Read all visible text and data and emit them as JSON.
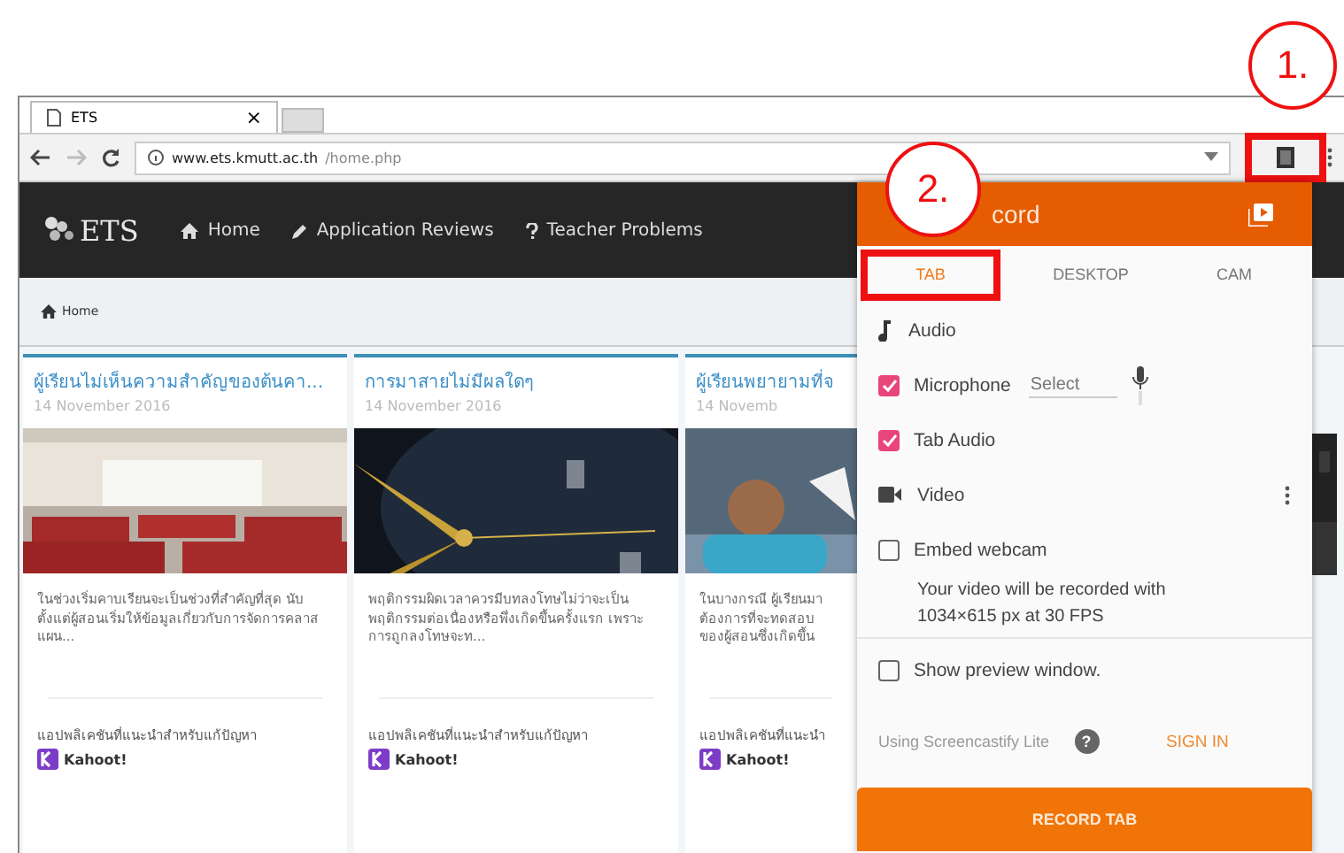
{
  "browser": {
    "tab_title": "ETS",
    "tab_close": "×",
    "url_host": "www.ets.kmutt.ac.th",
    "url_path": "/home.php"
  },
  "site": {
    "logo": "ETS",
    "nav": [
      {
        "label": "Home"
      },
      {
        "label": "Application Reviews"
      },
      {
        "label": "Teacher Problems"
      }
    ],
    "breadcrumb": "Home"
  },
  "cards": [
    {
      "title": "ผู้เรียนไม่เห็นความสำคัญของต้นคา...",
      "date": "14 November 2016",
      "body": "ในช่วงเริ่มคาบเรียนจะเป็นช่วงที่สำคัญที่สุด นับตั้งแต่ผู้สอนเริ่มให้ข้อมูลเกี่ยวกับการจัดการคลาส แผน...",
      "footer": "แอปพลิเคชันที่แนะนำสำหรับแก้ปัญหา",
      "app": "Kahoot!"
    },
    {
      "title": "การมาสายไม่มีผลใดๆ",
      "date": "14 November 2016",
      "body": "พฤติกรรมผิดเวลาควรมีบทลงโทษไม่ว่าจะเป็นพฤติกรรมต่อเนื่องหรือพึ่งเกิดขึ้นครั้งแรก เพราะการถูกลงโทษจะท...",
      "footer": "แอปพลิเคชันที่แนะนำสำหรับแก้ปัญหา",
      "app": "Kahoot!"
    },
    {
      "title": "ผู้เรียนพยายามที่จ",
      "date": "14 Novemb",
      "body": "ในบางกรณี ผู้เรียนมา\nต้องการที่จะทดสอบ\nของผู้สอนซึ่งเกิดขึ้น",
      "footer": "แอปพลิเคชันที่แนะนำ",
      "app": "Kahoot!"
    }
  ],
  "popup": {
    "title": "cord",
    "tabs": [
      {
        "label": "TAB",
        "selected": true
      },
      {
        "label": "DESKTOP",
        "selected": false
      },
      {
        "label": "CAM",
        "selected": false
      }
    ],
    "audio_heading": "Audio",
    "microphone": {
      "label": "Microphone",
      "checked": true,
      "placeholder": "Select"
    },
    "tab_audio": {
      "label": "Tab Audio",
      "checked": true
    },
    "video_heading": "Video",
    "embed_webcam": {
      "label": "Embed webcam",
      "checked": false
    },
    "video_note": "Your video will be recorded with\n1034×615 px at 30 FPS",
    "show_preview": {
      "label": "Show preview window.",
      "checked": false
    },
    "plan": "Using Screencastify Lite",
    "help": "?",
    "sign_in": "SIGN IN",
    "record_button": "RECORD TAB"
  },
  "annotations": [
    {
      "number": "1."
    },
    {
      "number": "2."
    }
  ]
}
